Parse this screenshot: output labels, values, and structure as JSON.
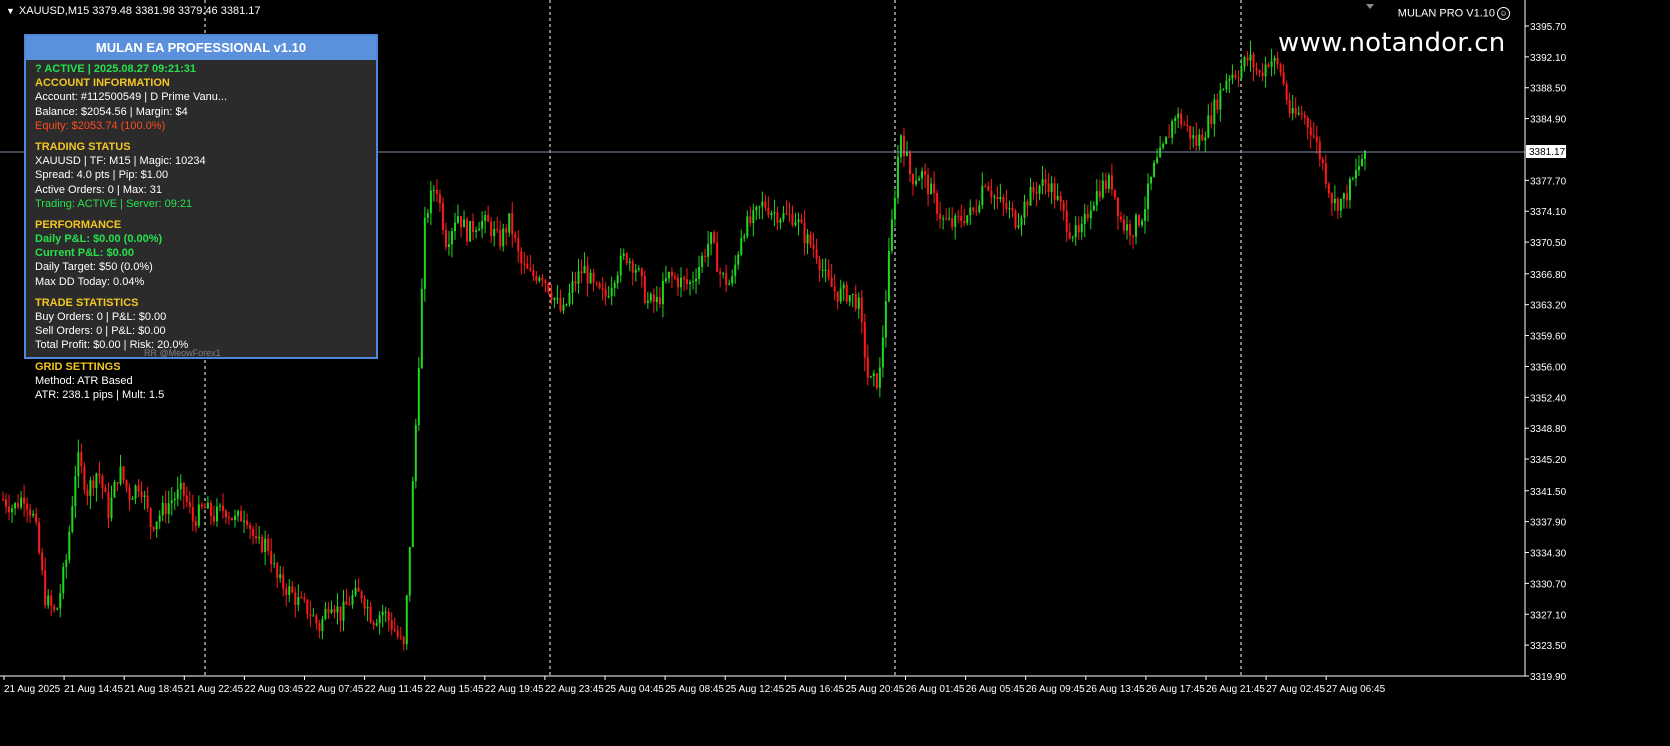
{
  "header": {
    "symbol_line": "XAUUSD,M15  3379.48 3381.98 3379.46 3381.17",
    "ea_name": "MULAN PRO V1.10",
    "watermark": "www.notandor.cn"
  },
  "panel": {
    "title": "MULAN EA PROFESSIONAL v1.10",
    "faint_text": "RR @MeowForex1",
    "status": "? ACTIVE | 2025.08.27 09:21:31",
    "account_header": "ACCOUNT INFORMATION",
    "account": "Account: #112500549 | D Prime Vanu...",
    "balance": "Balance: $2054.56 | Margin: $4",
    "equity": "Equity: $2053.74 (100.0%)",
    "trading_header": "TRADING STATUS",
    "symbol_info": "XAUUSD | TF: M15 | Magic: 10234",
    "spread": "Spread: 4.0 pts | Pip: $1.00",
    "orders": "Active Orders: 0 | Max: 31",
    "trading": "Trading: ACTIVE | Server: 09:21",
    "performance_header": "PERFORMANCE",
    "daily_pl": "Daily P&L: $0.00 (0.00%)",
    "current_pl": "Current P&L: $0.00",
    "daily_target": "Daily Target: $50 (0.0%)",
    "max_dd": "Max DD Today: 0.04%",
    "stats_header": "TRADE STATISTICS",
    "buy_orders": "Buy Orders: 0 | P&L: $0.00",
    "sell_orders": "Sell Orders: 0 | P&L: $0.00",
    "total_profit": "Total Profit: $0.00 | Risk: 20.0%",
    "grid_header": "GRID SETTINGS",
    "method": "Method: ATR Based",
    "atr": "ATR: 238.1 pips | Mult: 1.5"
  },
  "price_axis": {
    "labels": [
      "3395.70",
      "3392.10",
      "3388.50",
      "3384.90",
      "3381.17",
      "3377.70",
      "3374.10",
      "3370.50",
      "3366.80",
      "3363.20",
      "3359.60",
      "3356.00",
      "3352.40",
      "3348.80",
      "3345.20",
      "3341.50",
      "3337.90",
      "3334.30",
      "3330.70",
      "3327.10",
      "3323.50",
      "3319.90"
    ],
    "current_price": "3381.17"
  },
  "time_axis": {
    "labels": [
      "21 Aug 2025",
      "21 Aug 14:45",
      "21 Aug 18:45",
      "21 Aug 22:45",
      "22 Aug 03:45",
      "22 Aug 07:45",
      "22 Aug 11:45",
      "22 Aug 15:45",
      "22 Aug 19:45",
      "22 Aug 23:45",
      "25 Aug 04:45",
      "25 Aug 08:45",
      "25 Aug 12:45",
      "25 Aug 16:45",
      "25 Aug 20:45",
      "26 Aug 01:45",
      "26 Aug 05:45",
      "26 Aug 09:45",
      "26 Aug 13:45",
      "26 Aug 17:45",
      "26 Aug 21:45",
      "27 Aug 02:45",
      "27 Aug 06:45"
    ]
  },
  "chart_data": {
    "type": "candlestick",
    "symbol": "XAUUSD",
    "timeframe": "M15",
    "ohlc_last": {
      "open": 3379.48,
      "high": 3381.98,
      "low": 3379.46,
      "close": 3381.17
    },
    "ylim": [
      3319.9,
      3395.7
    ],
    "colors": {
      "up": "#1fd81f",
      "down": "#ff1a1a",
      "background": "#000000",
      "grid": "#ffffff",
      "price_line": "#7d8fa8"
    },
    "path_closes": [
      3340.5,
      3339.5,
      3341.0,
      3338.0,
      3329.0,
      3327.0,
      3333.5,
      3345.5,
      3341.5,
      3344.0,
      3339.0,
      3344.0,
      3341.0,
      3342.5,
      3337.5,
      3339.0,
      3340.5,
      3341.5,
      3338.0,
      3339.5,
      3338.5,
      3339.5,
      3338.0,
      3339.0,
      3335.0,
      3335.5,
      3331.0,
      3330.0,
      3328.5,
      3327.5,
      3325.5,
      3329.0,
      3327.0,
      3329.0,
      3329.5,
      3326.5,
      3327.5,
      3325.5,
      3323.0,
      3346.5,
      3373.5,
      3377.5,
      3370.5,
      3374.0,
      3371.5,
      3373.0,
      3372.5,
      3370.5,
      3373.0,
      3368.0,
      3366.5,
      3367.0,
      3364.5,
      3362.0,
      3365.5,
      3367.5,
      3365.0,
      3364.0,
      3367.0,
      3369.0,
      3367.5,
      3363.5,
      3363.5,
      3366.5,
      3366.0,
      3365.5,
      3368.0,
      3371.0,
      3366.5,
      3365.5,
      3372.0,
      3373.0,
      3375.0,
      3374.0,
      3373.5,
      3373.5,
      3371.0,
      3369.5,
      3366.0,
      3364.5,
      3364.5,
      3363.5,
      3354.0,
      3354.5,
      3370.0,
      3383.5,
      3378.0,
      3378.5,
      3376.0,
      3373.0,
      3372.5,
      3373.5,
      3374.0,
      3378.0,
      3375.5,
      3374.5,
      3373.0,
      3375.5,
      3377.0,
      3377.5,
      3375.0,
      3372.0,
      3371.0,
      3375.0,
      3377.0,
      3377.5,
      3372.5,
      3372.0,
      3374.0,
      3379.0,
      3381.5,
      3385.5,
      3384.0,
      3382.0,
      3384.0,
      3387.0,
      3390.0,
      3390.5,
      3392.0,
      3390.0,
      3392.0,
      3390.5,
      3385.0,
      3385.5,
      3383.5,
      3379.5,
      3375.0,
      3375.5,
      3378.0,
      3381.2
    ]
  }
}
